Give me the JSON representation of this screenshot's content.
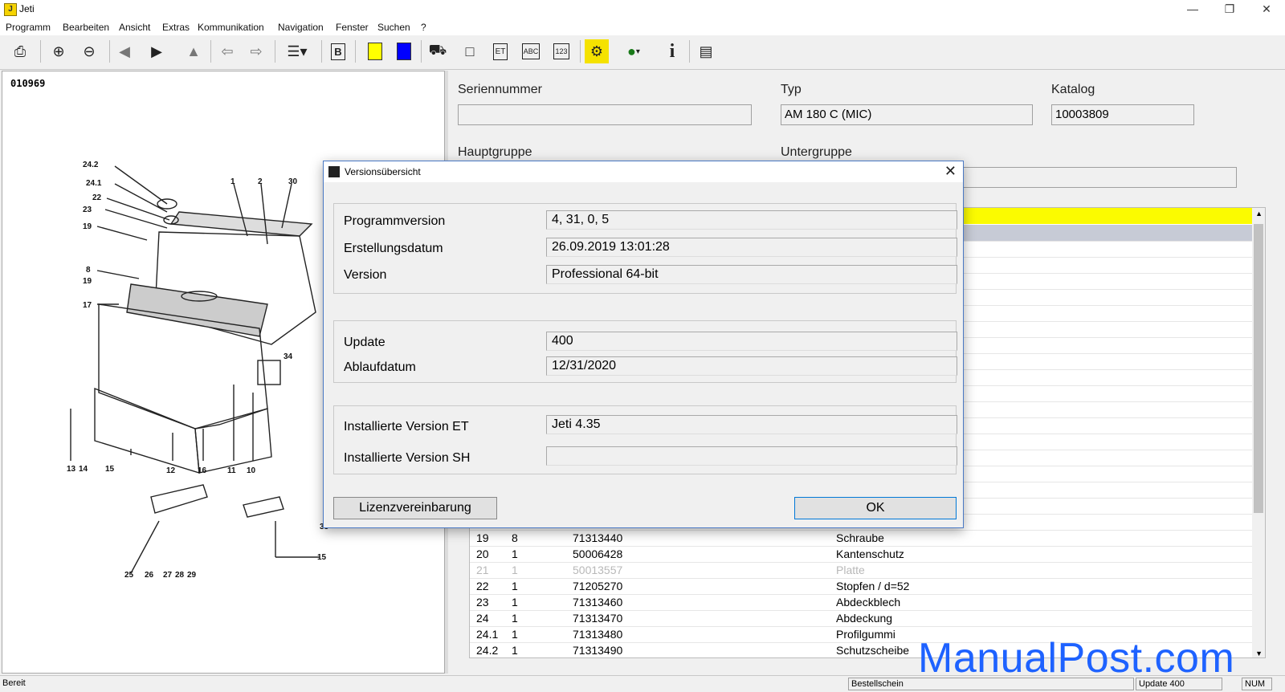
{
  "window": {
    "title": "Jeti"
  },
  "menu": [
    "Programm",
    "Bearbeiten",
    "Ansicht",
    "Extras",
    "Kommunikation",
    "Navigation",
    "Fenster",
    "Suchen",
    "?"
  ],
  "toolbar": {
    "icons": [
      "print-icon",
      "zoom-in-icon",
      "zoom-out-icon",
      "arrow-left-icon",
      "arrow-right-icon",
      "arrow-up-icon",
      "back-icon",
      "forward-icon",
      "tree-icon",
      "bookmark-icon",
      "yellow-color-icon",
      "blue-color-icon",
      "truck-icon",
      "document-icon",
      "et-icon",
      "abc-icon",
      "123-icon",
      "machine-icon",
      "globe-icon",
      "info-icon",
      "cabinet-icon"
    ],
    "et": "ET",
    "abc": "ABC",
    "num": "123",
    "b": "B"
  },
  "left": {
    "drawing_id": "010969"
  },
  "fields": {
    "serial_label": "Seriennummer",
    "serial_value": "",
    "type_label": "Typ",
    "type_value": "AM 180 C (MIC)",
    "catalog_label": "Katalog",
    "catalog_value": "10003809",
    "main_group_label": "Hauptgruppe",
    "sub_group_label": "Untergruppe"
  },
  "table": {
    "rows": [
      {
        "pos": "19",
        "qty": "8",
        "part": "71313440",
        "desc": "Schraube",
        "gray": false
      },
      {
        "pos": "20",
        "qty": "1",
        "part": "50006428",
        "desc": "Kantenschutz",
        "gray": false
      },
      {
        "pos": "21",
        "qty": "1",
        "part": "50013557",
        "desc": "Platte",
        "gray": true
      },
      {
        "pos": "22",
        "qty": "1",
        "part": "71205270",
        "desc": "Stopfen / d=52",
        "gray": false
      },
      {
        "pos": "23",
        "qty": "1",
        "part": "71313460",
        "desc": "Abdeckblech",
        "gray": false
      },
      {
        "pos": "24",
        "qty": "1",
        "part": "71313470",
        "desc": "Abdeckung",
        "gray": false
      },
      {
        "pos": "24.1",
        "qty": "1",
        "part": "71313480",
        "desc": "Profilgummi",
        "gray": false
      },
      {
        "pos": "24.2",
        "qty": "1",
        "part": "71313490",
        "desc": "Schutzscheibe",
        "gray": false
      }
    ]
  },
  "dialog": {
    "title": "Versionsübersicht",
    "program_version_label": "Programmversion",
    "program_version": "4, 31, 0, 5",
    "build_date_label": "Erstellungsdatum",
    "build_date": "26.09.2019 13:01:28",
    "version_label": "Version",
    "version": "Professional 64-bit",
    "update_label": "Update",
    "update": "400",
    "expiry_label": "Ablaufdatum",
    "expiry": "12/31/2020",
    "installed_et_label": "Installierte Version ET",
    "installed_et": "Jeti 4.35",
    "installed_sh_label": "Installierte Version SH",
    "installed_sh": "",
    "license_button": "Lizenzvereinbarung",
    "ok_button": "OK"
  },
  "status": {
    "ready": "Bereit",
    "order": "Bestellschein",
    "update": "Update 400",
    "num": "NUM"
  },
  "watermark": "ManualPost.com",
  "colors": {
    "grid_highlight": "#fbfb00",
    "watermark": "#1e62ff",
    "dialog_border": "#4a79c4"
  }
}
